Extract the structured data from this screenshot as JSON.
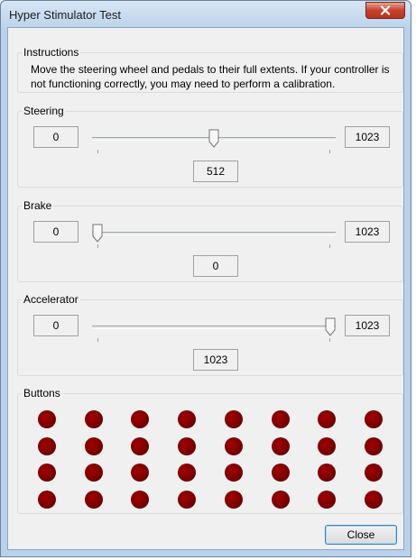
{
  "window": {
    "title": "Hyper Stimulator Test"
  },
  "instructions": {
    "label": "Instructions",
    "text": "Move the steering wheel and pedals to their full extents. If your controller is not functioning correctly, you may need to perform a calibration."
  },
  "axes": [
    {
      "label": "Steering",
      "min": "0",
      "max": "1023",
      "value": "512",
      "fraction": 0.5
    },
    {
      "label": "Brake",
      "min": "0",
      "max": "1023",
      "value": "0",
      "fraction": 0.0
    },
    {
      "label": "Accelerator",
      "min": "0",
      "max": "1023",
      "value": "1023",
      "fraction": 1.0
    }
  ],
  "buttons": {
    "label": "Buttons",
    "rows": 4,
    "cols": 8,
    "count": 32,
    "pressed": [],
    "indicator_color": "#7a0000"
  },
  "footer": {
    "close_label": "Close"
  }
}
